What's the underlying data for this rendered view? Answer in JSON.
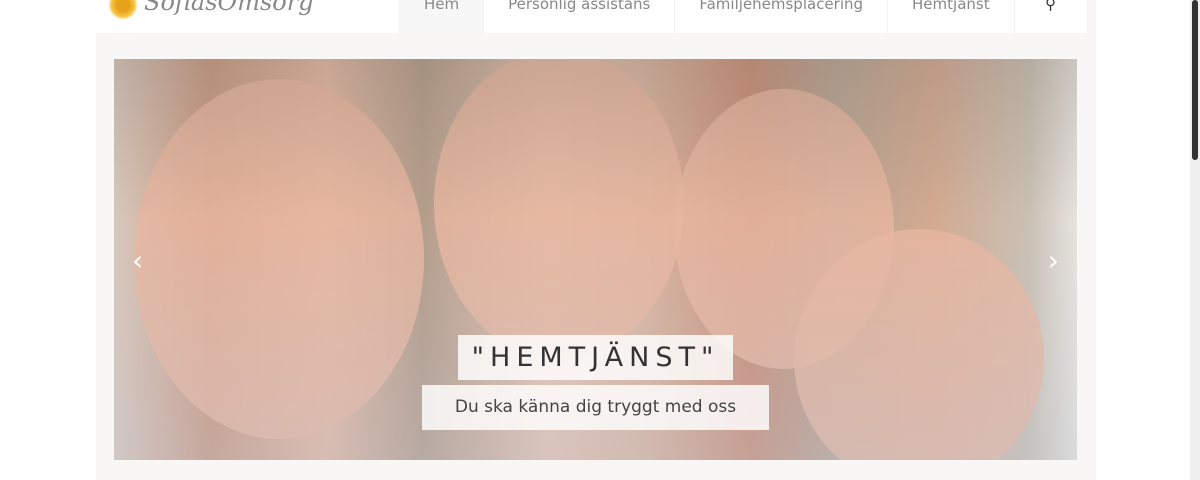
{
  "logo": {
    "text": "SofiasOmsorg"
  },
  "nav": {
    "items": [
      {
        "label": "Hem",
        "active": true
      },
      {
        "label": "Personlig assistans"
      },
      {
        "label": "Familjehemsplacering"
      },
      {
        "label": "Hemtjänst"
      }
    ],
    "search_icon": "search-icon"
  },
  "slider": {
    "title": "\"HEMTJÄNST\"",
    "subtitle": "Du ska känna dig tryggt med oss",
    "prev": "‹",
    "next": "›"
  }
}
